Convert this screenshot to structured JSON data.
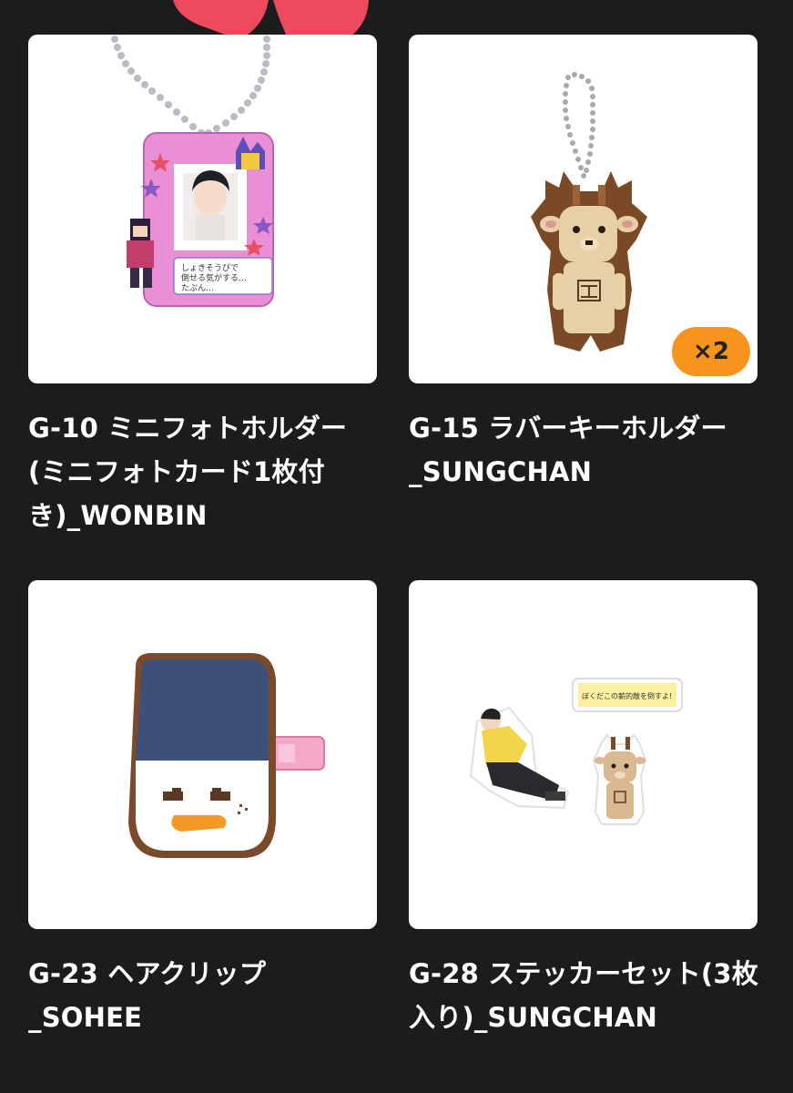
{
  "items": [
    {
      "title": "G-10 ミニフォトホルダー(ミニフォトカード1枚付き)_WONBIN",
      "image": "mini-photo-holder",
      "mini_text": "しょきそうびで 倒せる気がする… たぶん…"
    },
    {
      "title": "G-15 ラバーキーホルダー_SUNGCHAN",
      "image": "rubber-keychain-deer",
      "badge": "×2",
      "badge_color": "#f7941d"
    },
    {
      "title": "G-23 ヘアクリップ_SOHEE",
      "image": "hair-clip-penguin"
    },
    {
      "title": "G-28 ステッカーセット(3枚入り)_SUNGCHAN",
      "image": "sticker-set",
      "sticker_text": "ぼくだこの薪的敵を倒すよ!"
    }
  ],
  "colors": {
    "background": "#1c1c1e",
    "card": "#ffffff",
    "text": "#ffffff",
    "heart": "#ee4a5d"
  }
}
